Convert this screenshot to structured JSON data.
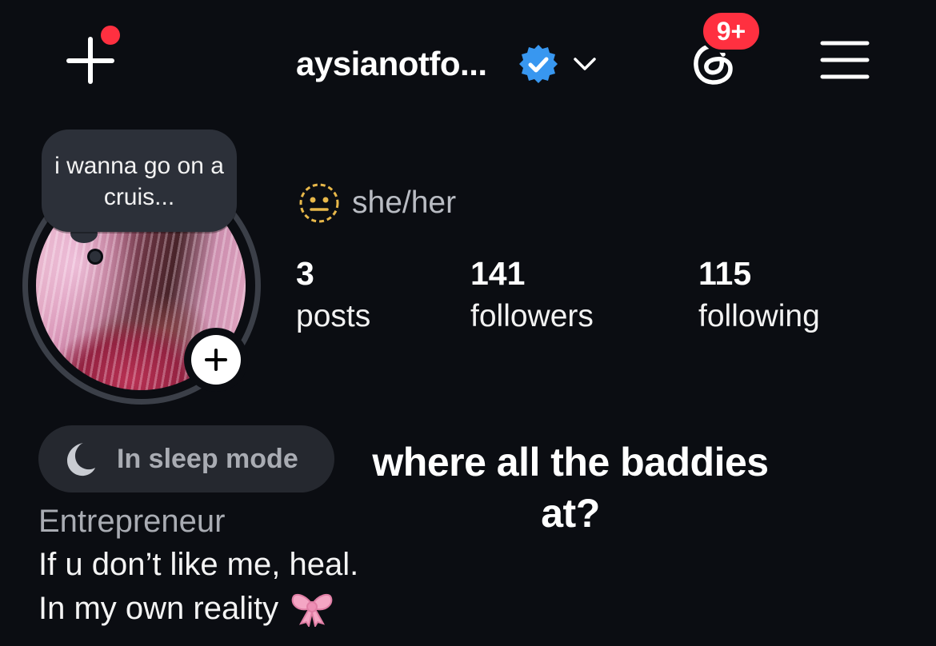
{
  "header": {
    "username": "aysianotfo...",
    "threads_badge": "9+",
    "icons": {
      "create": "plus-icon",
      "verified": "verified-badge-icon",
      "switch_account": "chevron-down-icon",
      "threads": "threads-icon",
      "menu": "hamburger-menu-icon"
    }
  },
  "note": {
    "text": "i wanna go on a cruis..."
  },
  "profile": {
    "pronouns_icon": "neutral-face-emoji-icon",
    "pronouns": "she/her",
    "stats": [
      {
        "value": "3",
        "label": "posts"
      },
      {
        "value": "141",
        "label": "followers"
      },
      {
        "value": "115",
        "label": "following"
      }
    ]
  },
  "status": {
    "icon": "moon-icon",
    "label": "In sleep mode"
  },
  "overlay_caption": "where all the baddies at?",
  "bio": {
    "category": "Entrepreneur",
    "line1": "If u don’t like me, heal.",
    "line2": "In my own reality",
    "line2_emoji": "ribbon-bow-icon"
  },
  "colors": {
    "background": "#0b0d12",
    "badge_red": "#ff3040",
    "verified_blue": "#3897f0",
    "muted_text": "#a9acb3",
    "pill_bg": "#25282f"
  }
}
